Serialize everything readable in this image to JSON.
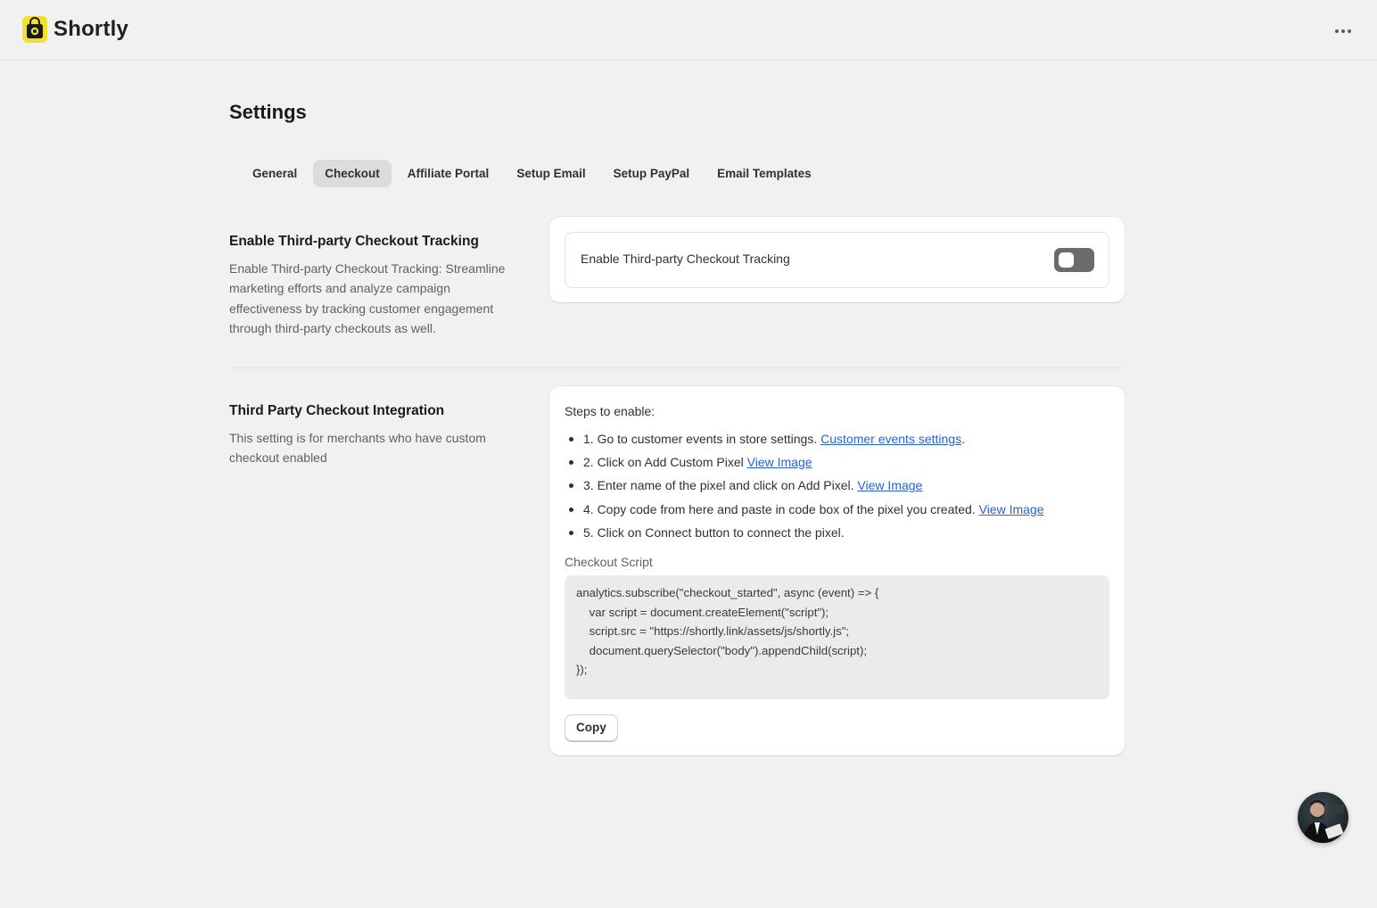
{
  "app": {
    "name": "Shortly",
    "logo_icon": "shopping-bag-icon",
    "accent_color": "#f5df2e"
  },
  "header": {
    "more_icon": "more-horizontal-icon"
  },
  "page": {
    "title": "Settings"
  },
  "tabs": [
    {
      "label": "General",
      "active": false
    },
    {
      "label": "Checkout",
      "active": true
    },
    {
      "label": "Affiliate Portal",
      "active": false
    },
    {
      "label": "Setup Email",
      "active": false
    },
    {
      "label": "Setup PayPal",
      "active": false
    },
    {
      "label": "Email Templates",
      "active": false
    }
  ],
  "tracking_section": {
    "title": "Enable Third-party Checkout Tracking",
    "description": "Enable Third-party Checkout Tracking: Streamline marketing efforts and analyze campaign effectiveness by tracking customer engagement through third-party checkouts as well.",
    "toggle_label": "Enable Third-party Checkout Tracking",
    "toggle_on": false
  },
  "integration_section": {
    "title": "Third Party Checkout Integration",
    "description": "This setting is for merchants who have custom checkout enabled",
    "steps_heading": "Steps to enable:",
    "steps": [
      {
        "text": "1. Go to customer events in store settings. ",
        "link": "Customer events settings",
        "suffix": "."
      },
      {
        "text": "2. Click on Add Custom Pixel ",
        "link": "View Image",
        "suffix": ""
      },
      {
        "text": "3. Enter name of the pixel and click on Add Pixel. ",
        "link": "View Image",
        "suffix": ""
      },
      {
        "text": "4. Copy code from here and paste in code box of the pixel you created. ",
        "link": "View Image",
        "suffix": ""
      },
      {
        "text": "5. Click on Connect button to connect the pixel.",
        "link": "",
        "suffix": ""
      }
    ],
    "script_label": "Checkout Script",
    "script_code": "analytics.subscribe(\"checkout_started\", async (event) => {\n    var script = document.createElement(\"script\");\n    script.src = \"https://shortly.link/assets/js/shortly.js\";\n    document.querySelector(\"body\").appendChild(script);\n});",
    "copy_label": "Copy"
  },
  "chat": {
    "icon": "support-avatar"
  }
}
